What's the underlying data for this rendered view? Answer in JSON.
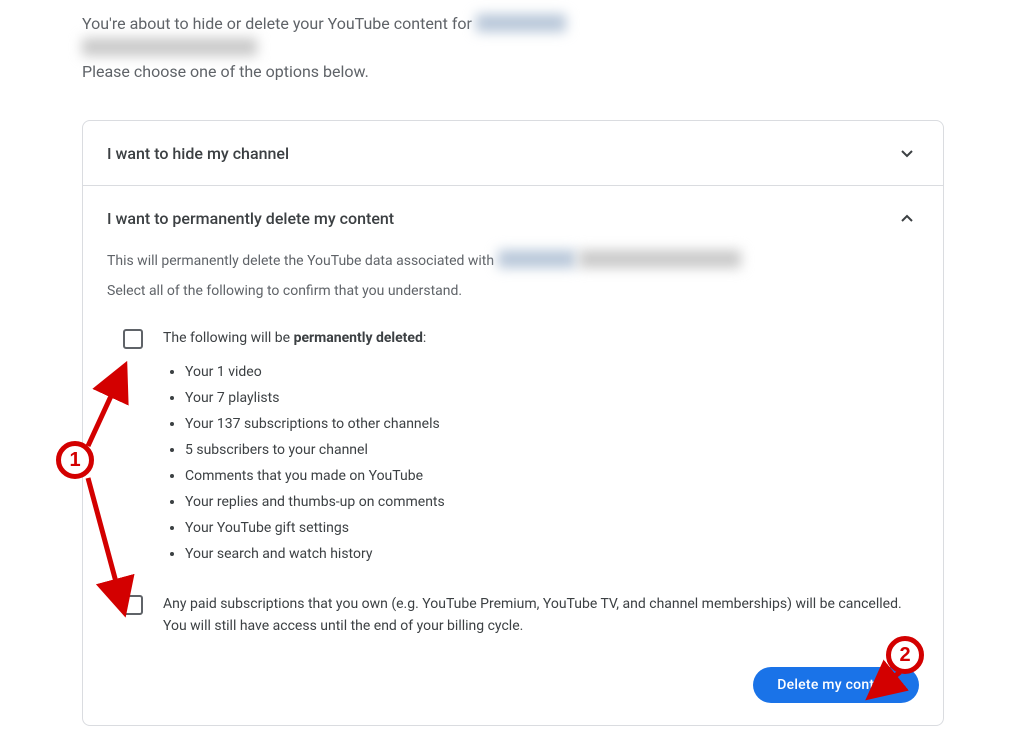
{
  "intro": {
    "line1_prefix": "You're about to hide or delete your YouTube content for ",
    "line3": "Please choose one of the options below."
  },
  "hide_section": {
    "title": "I want to hide my channel"
  },
  "delete_section": {
    "title": "I want to permanently delete my content",
    "desc_prefix": "This will permanently delete the YouTube data associated with ",
    "select_all": "Select all of the following to confirm that you understand.",
    "confirm1_lead_pre": "The following will be ",
    "confirm1_lead_strong": "permanently deleted",
    "confirm1_lead_post": ":",
    "items": [
      "Your 1 video",
      "Your 7 playlists",
      "Your 137 subscriptions to other channels",
      "5 subscribers to your channel",
      "Comments that you made on YouTube",
      "Your replies and thumbs-up on comments",
      "Your YouTube gift settings",
      "Your search and watch history"
    ],
    "confirm2": "Any paid subscriptions that you own (e.g. YouTube Premium, YouTube TV, and channel memberships) will be cancelled. You will still have access until the end of your billing cycle.",
    "button": "Delete my content"
  },
  "annotations": {
    "step1": "1",
    "step2": "2"
  }
}
